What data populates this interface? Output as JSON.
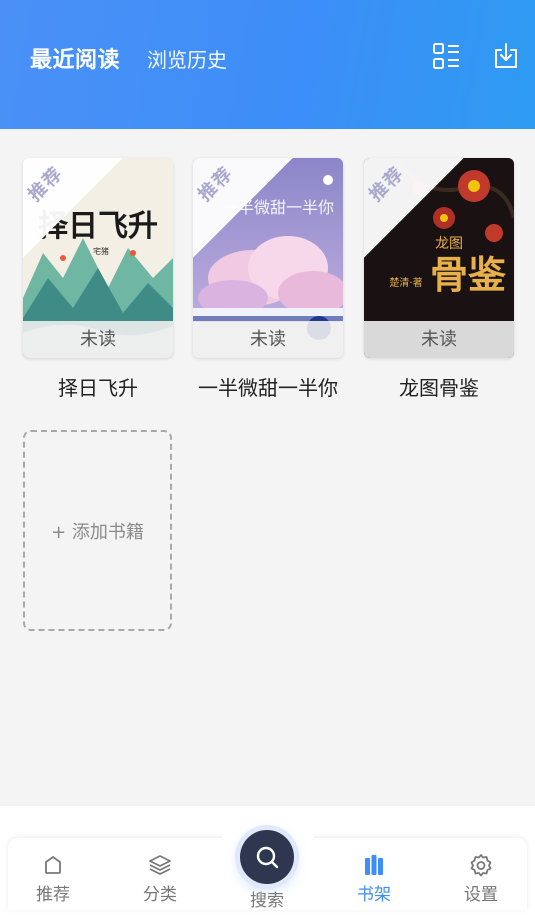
{
  "header": {
    "tab_active": "最近阅读",
    "tab_inactive": "浏览历史",
    "grid_icon": "grid-list-icon",
    "download_icon": "download-icon"
  },
  "books": [
    {
      "title": "择日飞升",
      "badge": "推荐",
      "status": "未读",
      "cover_title": "择日飞升",
      "cover_author": "宅猪"
    },
    {
      "title": "一半微甜一半你",
      "badge": "推荐",
      "status": "未读",
      "cover_title": "一半微甜一半你"
    },
    {
      "title": "龙图骨鉴",
      "badge": "推荐",
      "status": "未读",
      "cover_title": "骨鉴",
      "cover_subtitle": "龙图",
      "cover_author": "楚清·著"
    }
  ],
  "add_book": {
    "label": "+ 添加书籍"
  },
  "nav": {
    "items": [
      {
        "label": "推荐",
        "icon": "home-icon"
      },
      {
        "label": "分类",
        "icon": "layers-icon"
      },
      {
        "label": "搜索",
        "icon": "search-icon"
      },
      {
        "label": "书架",
        "icon": "bookshelf-icon"
      },
      {
        "label": "设置",
        "icon": "gear-icon"
      }
    ],
    "active": "书架"
  },
  "colors": {
    "header_start": "#4a90f7",
    "header_end": "#2e9bf2",
    "accent": "#3d8ef8",
    "background": "#f4f4f4"
  }
}
